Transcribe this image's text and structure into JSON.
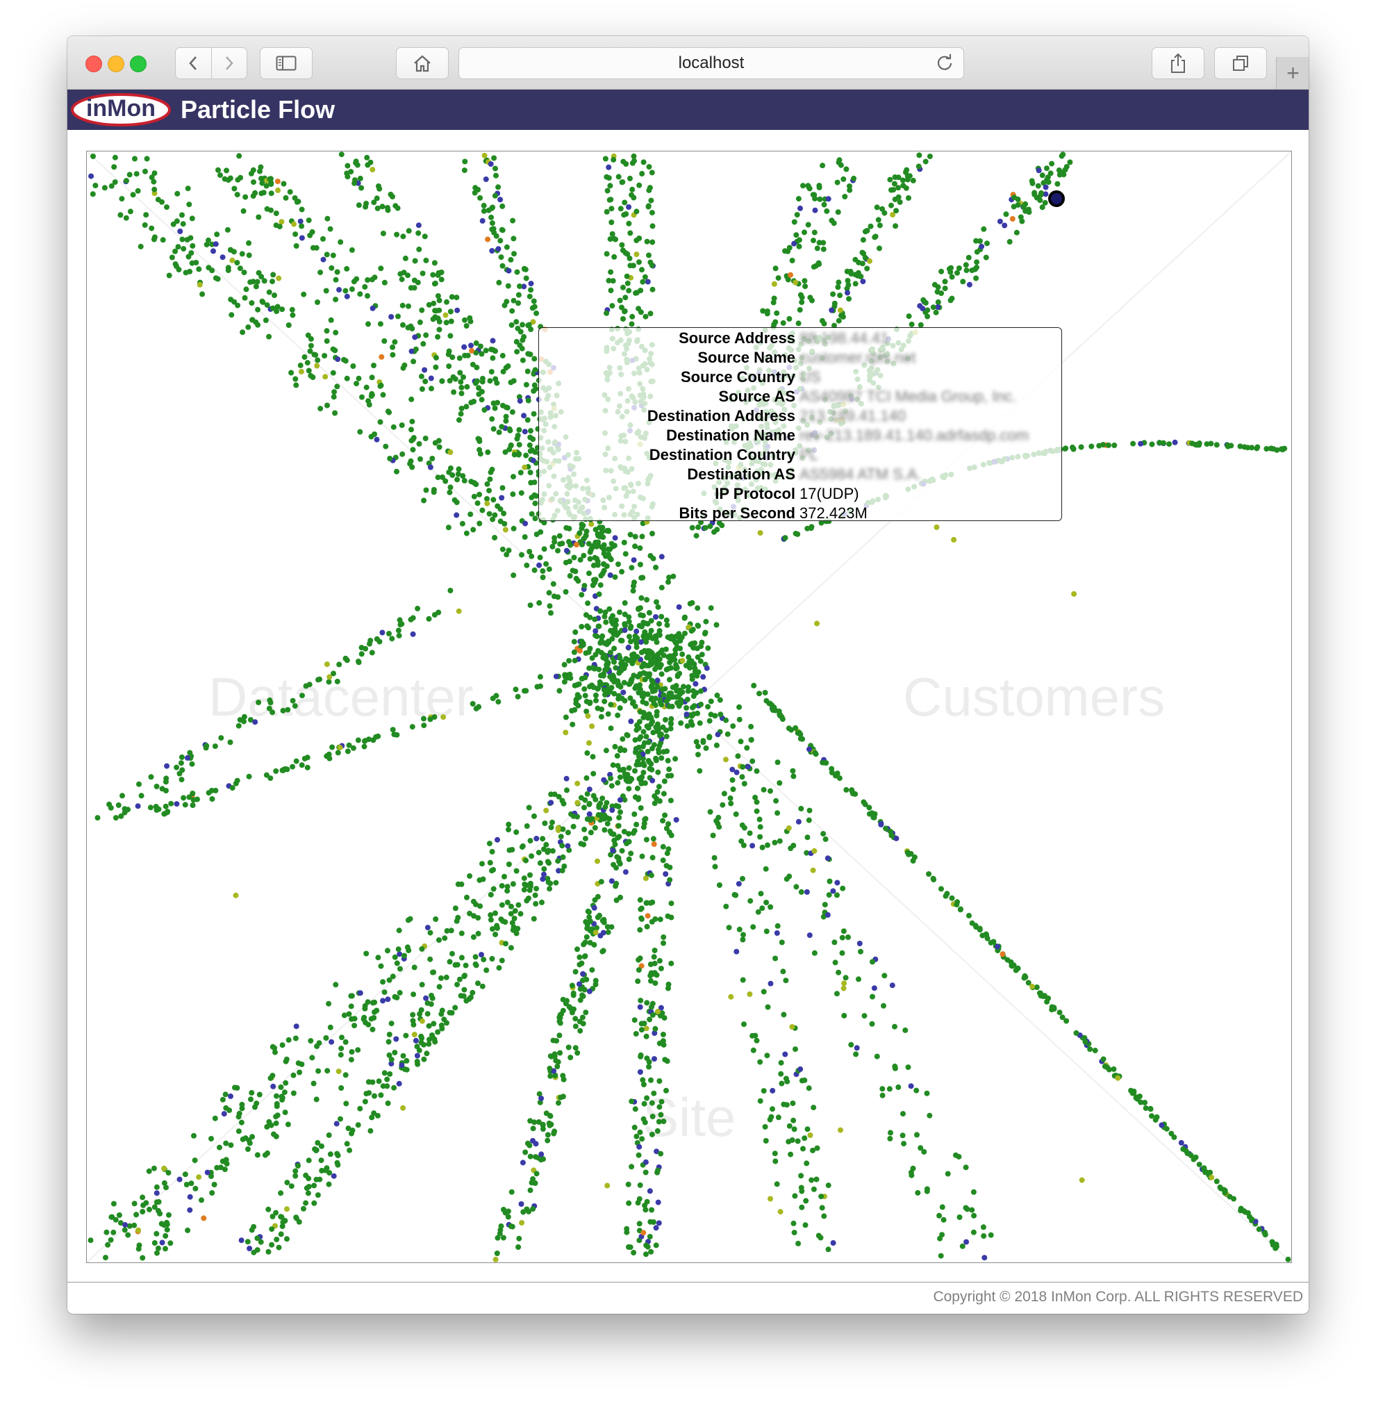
{
  "browser": {
    "url": "localhost",
    "new_tab_label": "+"
  },
  "app": {
    "logo_text": "inMon",
    "title": "Particle Flow"
  },
  "visualization": {
    "zones": {
      "left": "Datacenter",
      "right": "Customers",
      "bottom": "Site"
    },
    "colors": {
      "primary": "#228b22",
      "secondary": "#3a3aa8",
      "tertiary": "#a8b820",
      "accent": "#e07b20"
    }
  },
  "tooltip": {
    "rows": [
      {
        "key": "Source Address",
        "value": "88.198.44.41"
      },
      {
        "key": "Source Name",
        "value": "customer.rpls.net"
      },
      {
        "key": "Source Country",
        "value": "US"
      },
      {
        "key": "Source AS",
        "value": "AS40987 TCI Media Group, Inc."
      },
      {
        "key": "Destination Address",
        "value": "213.189.41.140"
      },
      {
        "key": "Destination Name",
        "value": "rev-213.189.41.140.adrfasdp.com"
      },
      {
        "key": "Destination Country",
        "value": "PL"
      },
      {
        "key": "Destination AS",
        "value": "AS5984 ATM S.A."
      },
      {
        "key": "IP Protocol",
        "value": "17(UDP)"
      },
      {
        "key": "Bits per Second",
        "value": "372.423M"
      }
    ]
  },
  "footer": {
    "copyright": "Copyright © 2018 InMon Corp. ALL RIGHTS RESERVED"
  }
}
